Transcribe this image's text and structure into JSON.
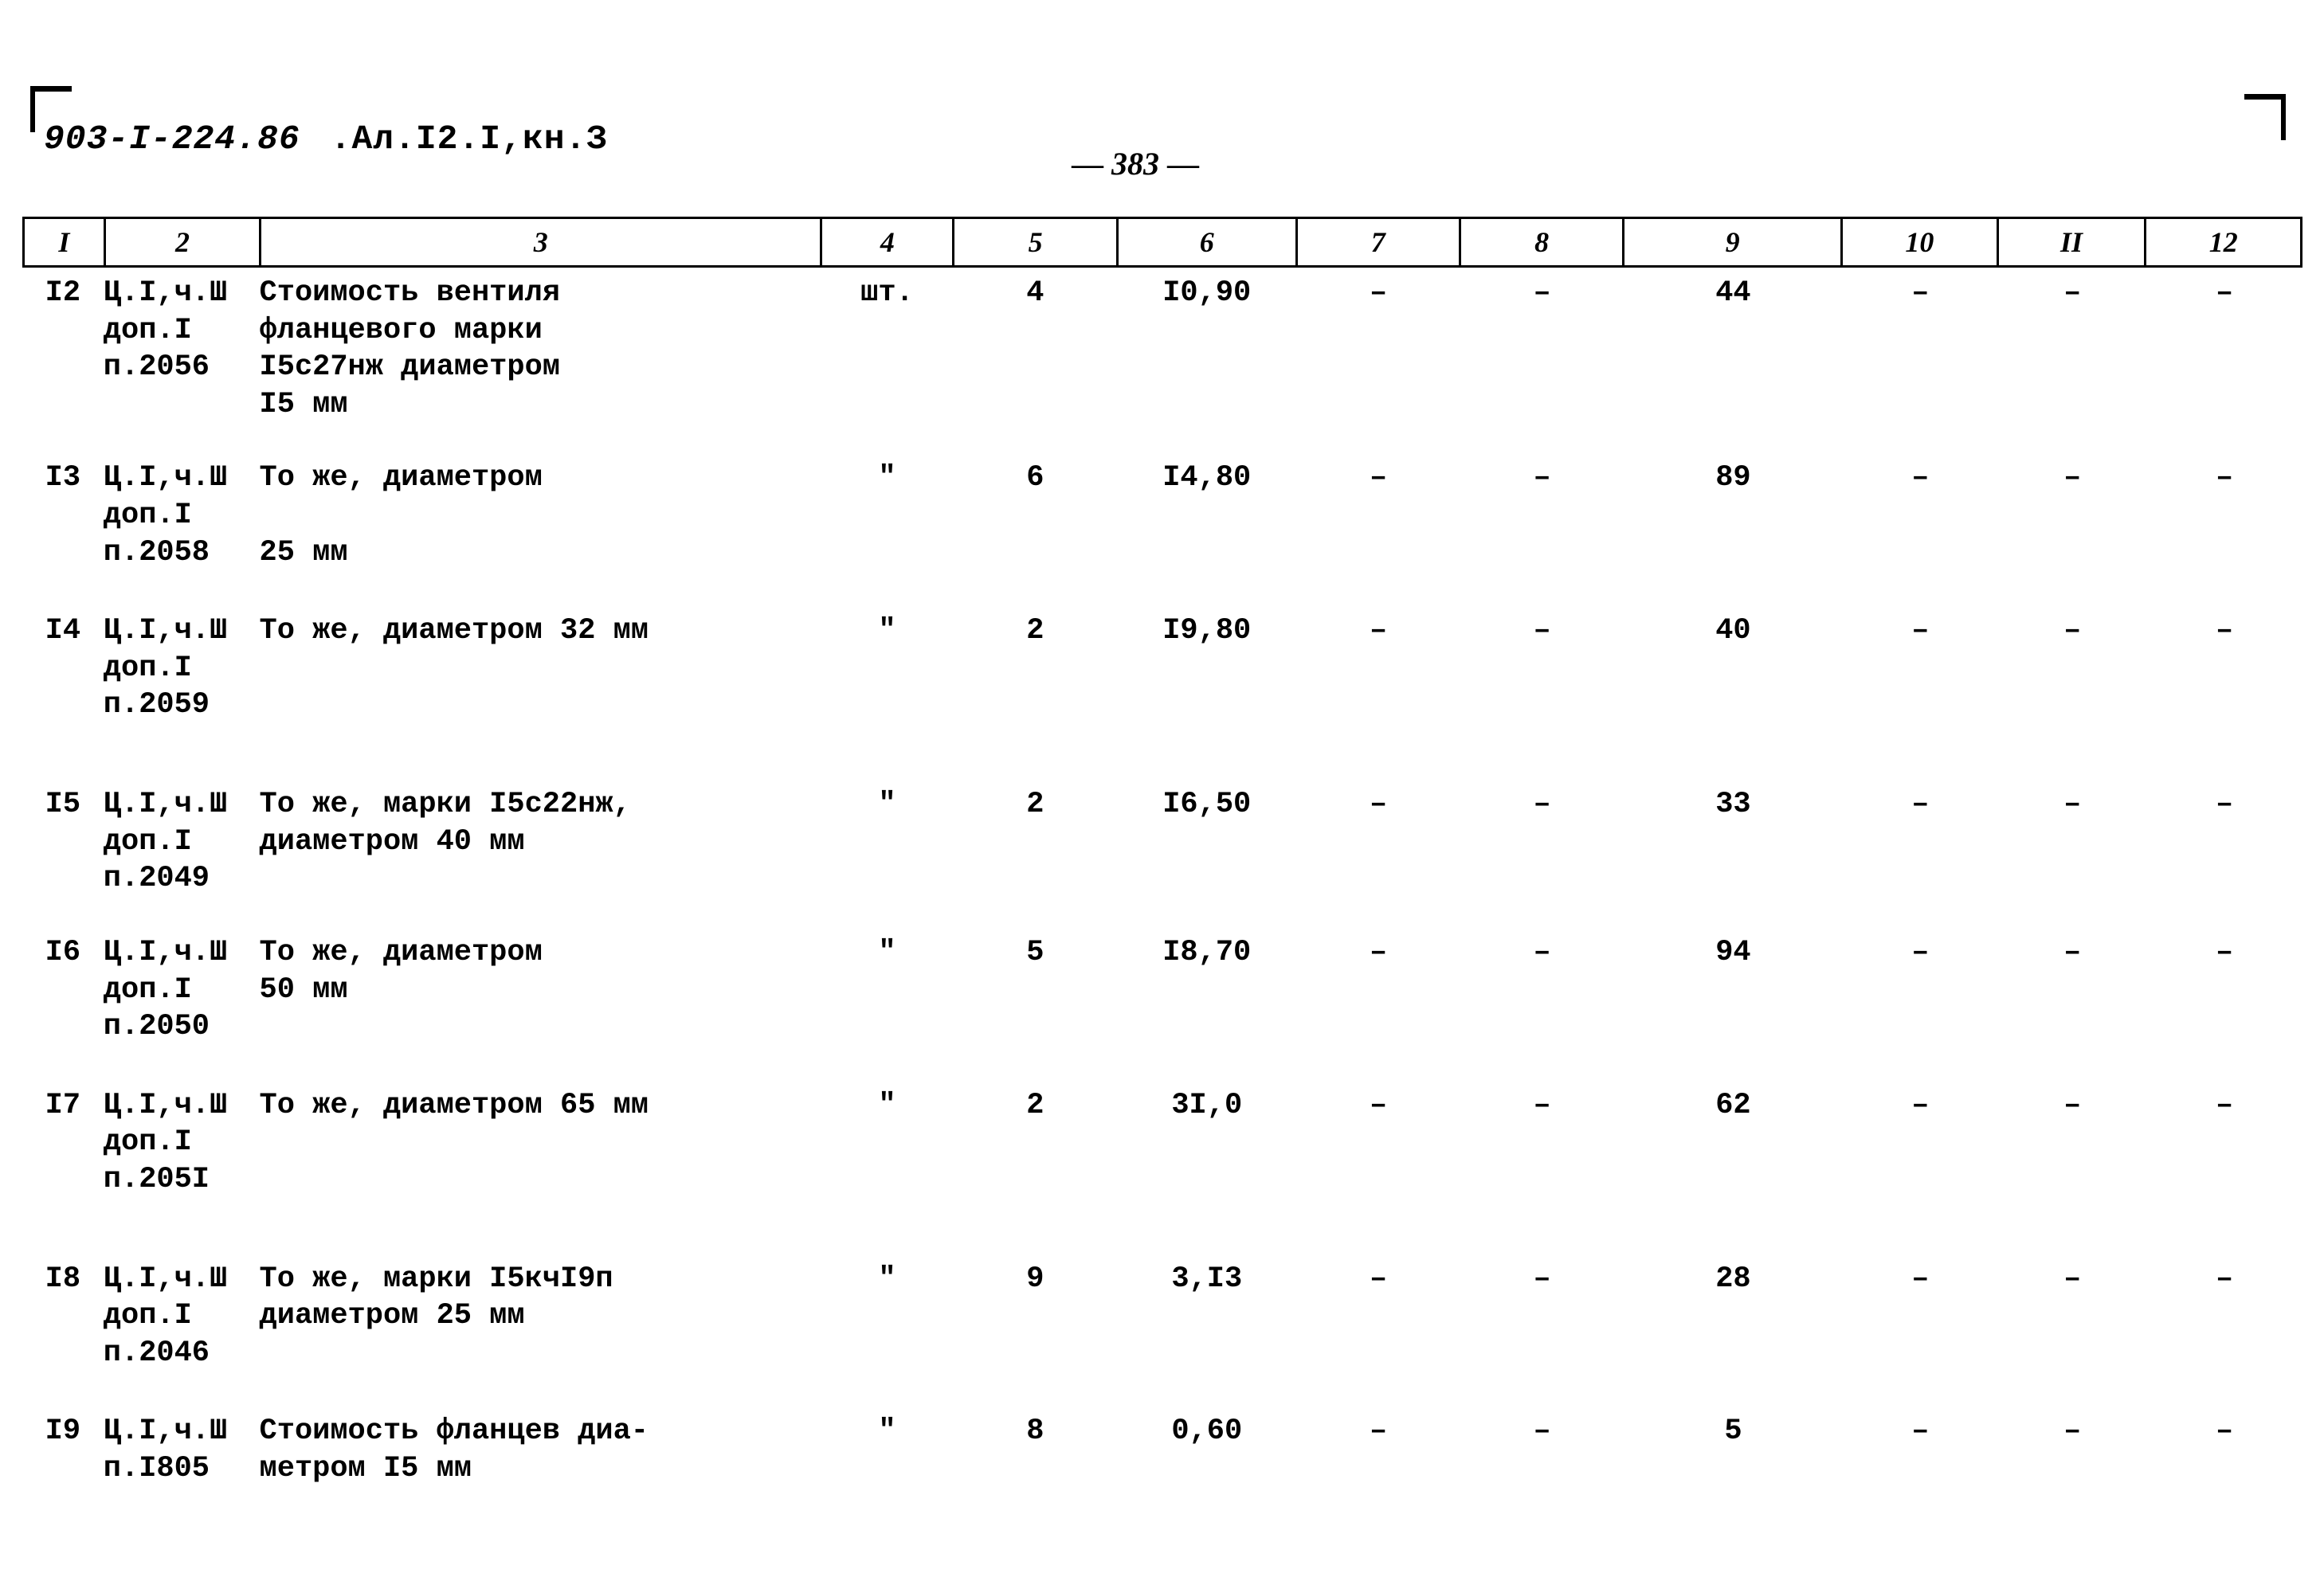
{
  "header": {
    "doc_code": "903-I-224.86",
    "album": ".Ал.I2.I,кн.З",
    "page_number": "383",
    "page_dash_left": "—",
    "page_dash_right": "—"
  },
  "table": {
    "column_headers": [
      "I",
      "2",
      "3",
      "4",
      "5",
      "6",
      "7",
      "8",
      "9",
      "10",
      "II",
      "12"
    ],
    "rows": [
      {
        "num": "I2",
        "ref": "Ц.I,ч.Ш\nдоп.I\nп.2056",
        "desc": "Стоимость вентиля\nфланцевого марки\nI5с27нж диаметром\nI5 мм",
        "unit": "шт.",
        "qty": "4",
        "price": "I0,90",
        "c7": "–",
        "c8": "–",
        "c9": "44",
        "c10": "–",
        "c11": "–",
        "c12": "–",
        "value_line": 3
      },
      {
        "num": "I3",
        "ref": "Ц.I,ч.Ш\nдоп.I\nп.2058",
        "desc": "То же, диаметром\n\n25 мм",
        "unit": "\"",
        "qty": "6",
        "price": "I4,80",
        "c7": "–",
        "c8": "–",
        "c9": "89",
        "c10": "–",
        "c11": "–",
        "c12": "–",
        "value_line": 1
      },
      {
        "num": "I4",
        "ref": "Ц.I,ч.Ш\nдоп.I\nп.2059",
        "desc": "То же, диаметром 32 мм",
        "unit": "\"",
        "qty": "2",
        "price": "I9,80",
        "c7": "–",
        "c8": "–",
        "c9": "40",
        "c10": "–",
        "c11": "–",
        "c12": "–",
        "value_line": 0
      },
      {
        "num": "I5",
        "ref": "Ц.I,ч.Ш\nдоп.I\nп.2049",
        "desc": "То же, марки I5с22нж,\nдиаметром 40 мм",
        "unit": "\"",
        "qty": "2",
        "price": "I6,50",
        "c7": "–",
        "c8": "–",
        "c9": "33",
        "c10": "–",
        "c11": "–",
        "c12": "–",
        "value_line": 1
      },
      {
        "num": "I6",
        "ref": "Ц.I,ч.Ш\nдоп.I\nп.2050",
        "desc": "То же, диаметром\n50 мм",
        "unit": "\"",
        "qty": "5",
        "price": "I8,70",
        "c7": "–",
        "c8": "–",
        "c9": "94",
        "c10": "–",
        "c11": "–",
        "c12": "–",
        "value_line": 1
      },
      {
        "num": "I7",
        "ref": "Ц.I,ч.Ш\nдоп.I\nп.205I",
        "desc": "То же, диаметром 65 мм",
        "unit": "\"",
        "qty": "2",
        "price": "3I,0",
        "c7": "–",
        "c8": "–",
        "c9": "62",
        "c10": "–",
        "c11": "–",
        "c12": "–",
        "value_line": 0
      },
      {
        "num": "I8",
        "ref": "Ц.I,ч.Ш\nдоп.I\nп.2046",
        "desc": "То же, марки I5кчI9п\nдиаметром 25 мм",
        "unit": "\"",
        "qty": "9",
        "price": "3,I3",
        "c7": "–",
        "c8": "–",
        "c9": "28",
        "c10": "–",
        "c11": "–",
        "c12": "–",
        "value_line": 1
      },
      {
        "num": "I9",
        "ref": "Ц.I,ч.Ш\nп.I805",
        "desc": "Стоимость фланцев диа-\nметром I5 мм",
        "unit": "\"",
        "qty": "8",
        "price": "0,60",
        "c7": "–",
        "c8": "–",
        "c9": "5",
        "c10": "–",
        "c11": "–",
        "c12": "–",
        "value_line": 1
      }
    ]
  }
}
